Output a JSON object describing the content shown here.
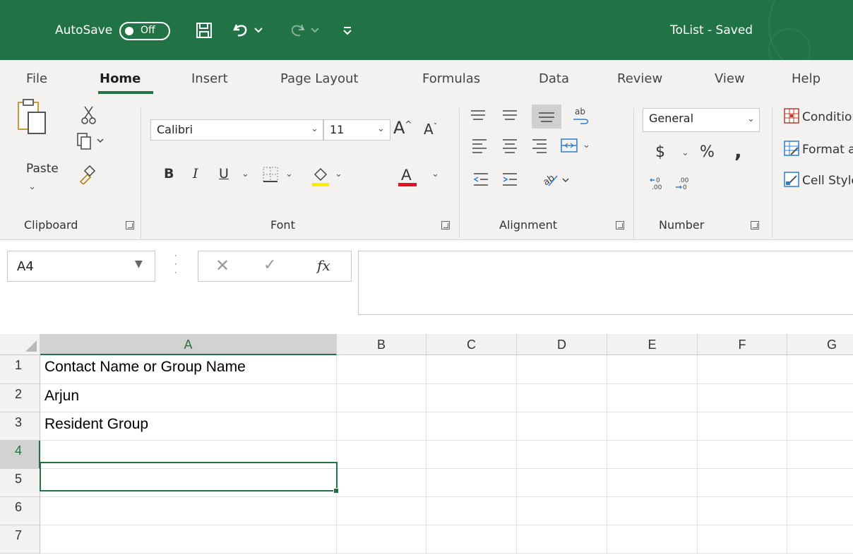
{
  "titlebar": {
    "autosave_label": "AutoSave",
    "autosave_state": "Off",
    "document_title": "ToList - Saved",
    "bg_color": "#217346",
    "icons": [
      "save-icon",
      "undo-icon",
      "redo-icon",
      "customize-quick-access-icon"
    ]
  },
  "ribbon": {
    "tabs": [
      "File",
      "Home",
      "Insert",
      "Page Layout",
      "Formulas",
      "Data",
      "Review",
      "View",
      "Help"
    ],
    "active_tab": "Home",
    "clipboard": {
      "paste_label": "Paste",
      "group_label": "Clipboard"
    },
    "font": {
      "family": "Calibri",
      "size": "11",
      "group_label": "Font",
      "bold": "B",
      "italic": "I",
      "underline": "U"
    },
    "alignment": {
      "group_label": "Alignment"
    },
    "number": {
      "format": "General",
      "currency": "$",
      "percent": "%",
      "comma": ",",
      "group_label": "Number"
    },
    "styles": {
      "items": [
        "Conditional Formatting",
        "Format as Table",
        "Cell Styles"
      ]
    }
  },
  "formula_bar": {
    "name_box": "A4",
    "fx_label": "fx",
    "content": ""
  },
  "sheet": {
    "columns": [
      "A",
      "B",
      "C",
      "D",
      "E",
      "F",
      "G"
    ],
    "selected_column": "A",
    "rows": [
      "1",
      "2",
      "3",
      "4",
      "5",
      "6",
      "7"
    ],
    "selected_row": "4",
    "cells_a": [
      "Contact Name or Group Name",
      "Arjun",
      "Resident Group",
      "",
      "",
      "",
      ""
    ],
    "accent_color": "#217346"
  }
}
